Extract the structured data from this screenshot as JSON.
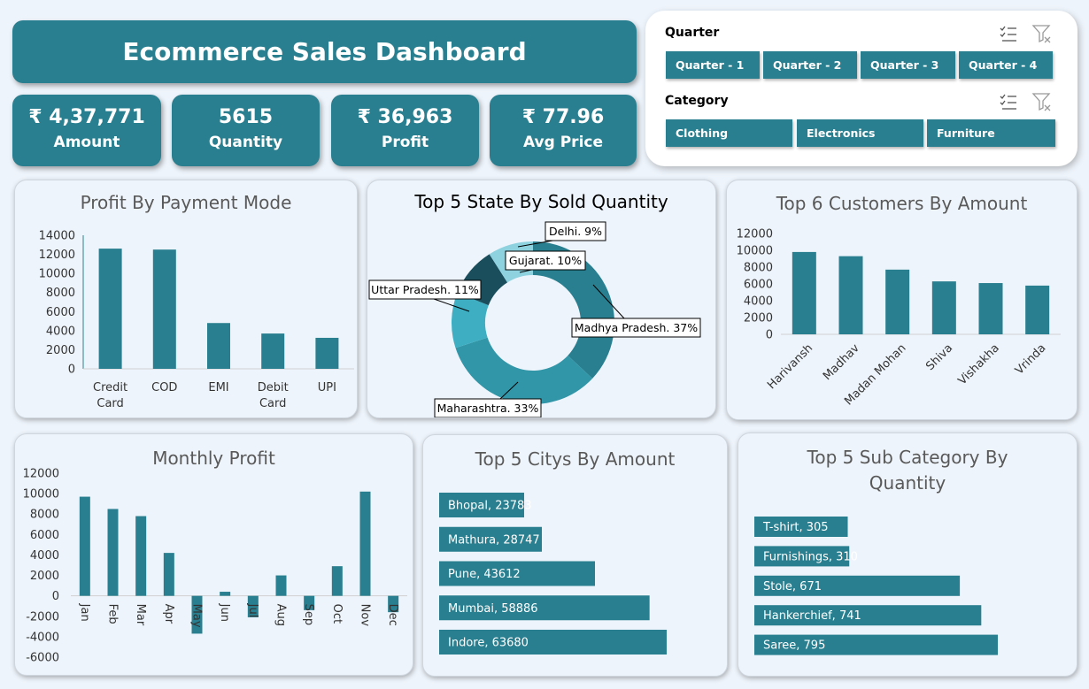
{
  "header": {
    "title": "Ecommerce Sales Dashboard"
  },
  "kpis": [
    {
      "value": "₹ 4,37,771",
      "label": "Amount"
    },
    {
      "value": "5615",
      "label": "Quantity"
    },
    {
      "value": "₹ 36,963",
      "label": "Profit"
    },
    {
      "value": "₹ 77.96",
      "label": "Avg Price"
    }
  ],
  "slicers": {
    "quarter": {
      "title": "Quarter",
      "items": [
        "Quarter - 1",
        "Quarter - 2",
        "Quarter - 3",
        "Quarter - 4"
      ]
    },
    "category": {
      "title": "Category",
      "items": [
        "Clothing",
        "Electronics",
        "Furniture"
      ]
    }
  },
  "colors": {
    "primary": "#297f8f",
    "bar": "#297f8f",
    "background": "#eef4fb"
  },
  "chart_data": [
    {
      "id": "payment",
      "type": "bar",
      "title": "Profit By Payment Mode",
      "categories": [
        "Credit Card",
        "COD",
        "EMI",
        "Debit Card",
        "UPI"
      ],
      "category_lines": [
        [
          "Credit",
          "Card"
        ],
        [
          "COD"
        ],
        [
          "EMI"
        ],
        [
          "Debit",
          "Card"
        ],
        [
          "UPI"
        ]
      ],
      "values": [
        12600,
        12500,
        4800,
        3700,
        3250
      ],
      "ylim": [
        0,
        14000
      ],
      "yticks": [
        0,
        2000,
        4000,
        6000,
        8000,
        10000,
        12000,
        14000
      ],
      "grid": false
    },
    {
      "id": "states",
      "type": "pie",
      "title": "Top 5 State By Sold Quantity",
      "labels": [
        "Madhya Pradesh",
        "Maharashtra",
        "Uttar Pradesh",
        "Gujarat",
        "Delhi"
      ],
      "values": [
        37,
        33,
        11,
        10,
        9
      ],
      "data_labels": [
        "Madhya Pradesh. 37%",
        "Maharashtra. 33%",
        "Uttar Pradesh. 11%",
        "Gujarat. 10%",
        "Delhi. 9%"
      ],
      "colors": [
        "#297f8f",
        "#3196a8",
        "#3eaec3",
        "#1a4e5c",
        "#8ed2e0"
      ]
    },
    {
      "id": "customers",
      "type": "bar",
      "title": "Top 6 Customers By Amount",
      "categories": [
        "Harivansh",
        "Madhav",
        "Madan Mohan",
        "Shiva",
        "Vishakha",
        "Vrinda"
      ],
      "values": [
        9800,
        9300,
        7700,
        6300,
        6100,
        5800
      ],
      "ylim": [
        0,
        12000
      ],
      "yticks": [
        0,
        2000,
        4000,
        6000,
        8000,
        10000,
        12000
      ],
      "grid": false
    },
    {
      "id": "monthly",
      "type": "bar",
      "title": "Monthly Profit",
      "categories": [
        "Jan",
        "Feb",
        "Mar",
        "Apr",
        "May",
        "Jun",
        "Jul",
        "Aug",
        "Sep",
        "Oct",
        "Nov",
        "Dec"
      ],
      "values": [
        9700,
        8500,
        7800,
        4200,
        -3700,
        400,
        -2100,
        2000,
        -1400,
        2900,
        10200,
        -1600
      ],
      "ylim": [
        -6000,
        12000
      ],
      "yticks": [
        -6000,
        -4000,
        -2000,
        0,
        2000,
        4000,
        6000,
        8000,
        10000,
        12000
      ],
      "grid": false
    },
    {
      "id": "cities",
      "type": "bar",
      "orientation": "horizontal",
      "title": "Top 5 Citys By Amount",
      "categories": [
        "Bhopal",
        "Mathura",
        "Pune",
        "Mumbai",
        "Indore"
      ],
      "values": [
        23783,
        28747,
        43612,
        58886,
        63680
      ],
      "data_labels": [
        "Bhopal, 23783",
        "Mathura, 28747",
        "Pune, 43612",
        "Mumbai, 58886",
        "Indore, 63680"
      ]
    },
    {
      "id": "subcategory",
      "type": "bar",
      "orientation": "horizontal",
      "title": "Top 5 Sub Category By Quantity",
      "title_lines": [
        "Top 5 Sub Category By",
        "Quantity"
      ],
      "categories": [
        "T-shirt",
        "Furnishings",
        "Stole",
        "Hankerchief",
        "Saree"
      ],
      "values": [
        305,
        310,
        671,
        741,
        795
      ],
      "data_labels": [
        "T-shirt, 305",
        "Furnishings, 310",
        "Stole, 671",
        "Hankerchief, 741",
        "Saree, 795"
      ]
    }
  ]
}
